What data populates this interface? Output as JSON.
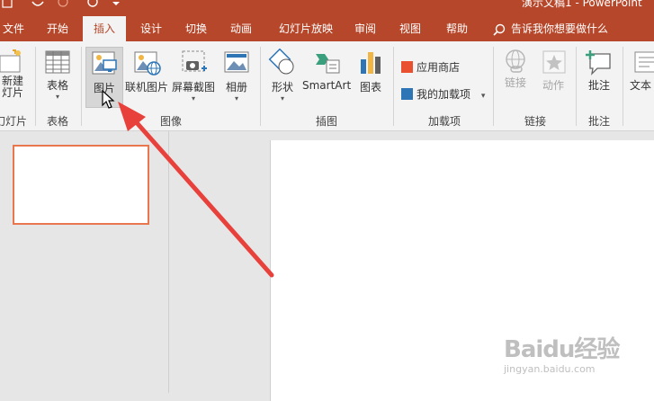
{
  "titlebar": {
    "doc_title": "演示文稿1 - PowerPoint"
  },
  "tabs": [
    {
      "label": "文件"
    },
    {
      "label": "开始"
    },
    {
      "label": "插入",
      "active": true
    },
    {
      "label": "设计"
    },
    {
      "label": "切换"
    },
    {
      "label": "动画"
    },
    {
      "label": "幻灯片放映"
    },
    {
      "label": "审阅"
    },
    {
      "label": "视图"
    },
    {
      "label": "帮助"
    }
  ],
  "tellme": {
    "label": "告诉我你想要做什么",
    "icon": "lightbulb-icon"
  },
  "ribbon": {
    "new_slide": {
      "line1": "新建",
      "line2": "灯片"
    },
    "table": {
      "label": "表格"
    },
    "picture": {
      "label": "图片"
    },
    "online_picture": {
      "label": "联机图片"
    },
    "screenshot": {
      "label": "屏幕截图"
    },
    "album": {
      "label": "相册"
    },
    "shapes": {
      "label": "形状"
    },
    "smartart": {
      "label": "SmartArt"
    },
    "chart": {
      "label": "图表"
    },
    "store": {
      "label": "应用商店"
    },
    "my_addins": {
      "label": "我的加载项"
    },
    "link": {
      "label": "链接"
    },
    "action": {
      "label": "动作"
    },
    "comment": {
      "label": "批注"
    },
    "textbox": {
      "label": "文本"
    },
    "groups": {
      "slides": "幻灯片",
      "tables": "表格",
      "images": "图像",
      "illustrations": "插图",
      "addins": "加载项",
      "links": "链接",
      "comments": "批注"
    }
  },
  "watermark": {
    "brand": "Baidu经验",
    "url": "jingyan.baidu.com"
  },
  "colors": {
    "accent": "#b7472a",
    "arrow": "#e8403a",
    "thumb_border": "#e8774f"
  }
}
